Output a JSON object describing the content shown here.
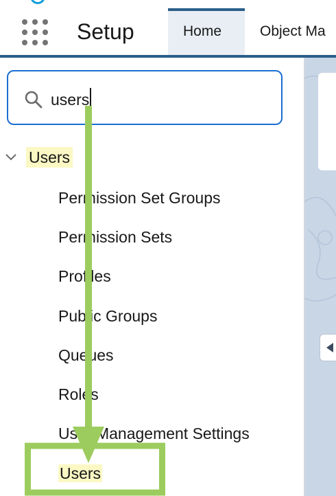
{
  "header": {
    "app_name": "Setup",
    "tabs": [
      {
        "label": "Home",
        "active": true
      },
      {
        "label": "Object Ma"
      }
    ]
  },
  "sidebar": {
    "search": {
      "value": "users"
    },
    "tree": {
      "parent": {
        "label": "Users",
        "expanded": true
      },
      "children": [
        {
          "label": "Permission Set Groups"
        },
        {
          "label": "Permission Sets"
        },
        {
          "label": "Profiles"
        },
        {
          "label": "Public Groups"
        },
        {
          "label": "Queues"
        },
        {
          "label": "Roles"
        },
        {
          "label": "User Management Settings"
        },
        {
          "label": "Users",
          "highlighted": true
        }
      ]
    }
  },
  "annotation": {
    "arrow_color": "#9ccc5e",
    "highlight_box_color": "#9ccc5e"
  },
  "colors": {
    "brand_bar": "#2a5e8a",
    "search_focus": "#1b6ed3",
    "match_highlight": "#fbf8c4"
  }
}
